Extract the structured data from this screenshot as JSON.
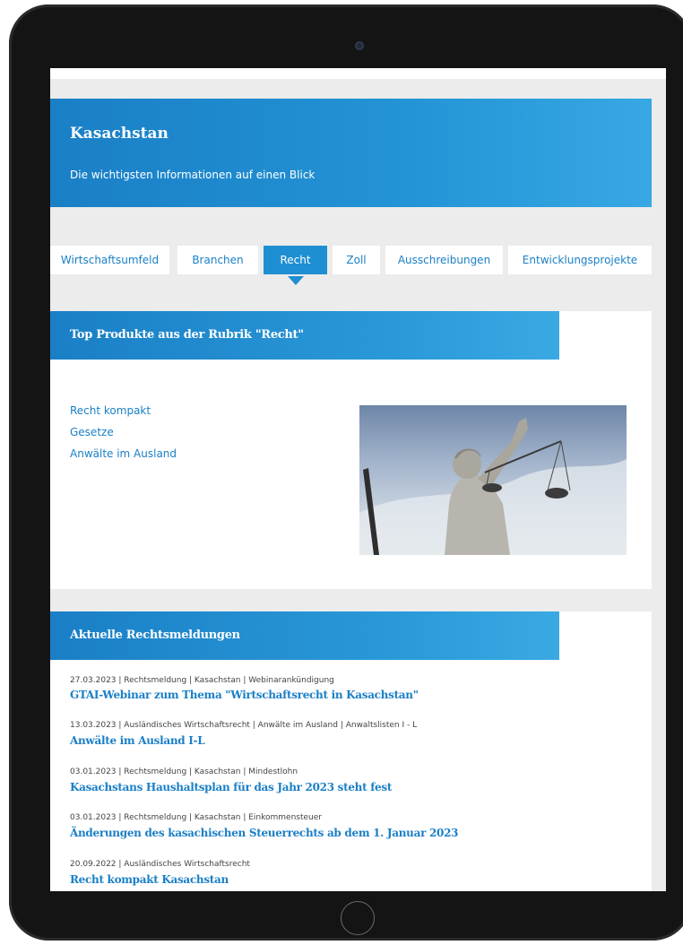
{
  "hero": {
    "title": "Kasachstan",
    "subtitle": "Die wichtigsten Informationen auf einen Blick"
  },
  "tabs": [
    {
      "label": "Wirtschaftsumfeld",
      "active": false
    },
    {
      "label": "Branchen",
      "active": false
    },
    {
      "label": "Recht",
      "active": true
    },
    {
      "label": "Zoll",
      "active": false
    },
    {
      "label": "Ausschreibungen",
      "active": false
    },
    {
      "label": "Entwicklungsprojekte",
      "active": false
    }
  ],
  "top_products": {
    "heading": "Top Produkte aus der Rubrik \"Recht\"",
    "links": [
      "Recht kompakt",
      "Gesetze",
      "Anwälte im Ausland"
    ],
    "image_icon": "justitia-statue-image"
  },
  "news": {
    "heading": "Aktuelle Rechtsmeldungen",
    "items": [
      {
        "meta": "27.03.2023 | Rechtsmeldung | Kasachstan | Webinarankündigung",
        "title": "GTAI-Webinar zum Thema \"Wirtschaftsrecht in Kasachstan\""
      },
      {
        "meta": "13.03.2023 | Ausländisches Wirtschaftsrecht | Anwälte im Ausland | Anwaltslisten I - L",
        "title": "Anwälte im Ausland I-L"
      },
      {
        "meta": "03.01.2023 | Rechtsmeldung | Kasachstan | Mindestlohn",
        "title": "Kasachstans Haushaltsplan für das Jahr 2023 steht fest"
      },
      {
        "meta": "03.01.2023 | Rechtsmeldung | Kasachstan | Einkommensteuer",
        "title": "Änderungen des kasachischen Steuerrechts ab dem 1. Januar 2023"
      },
      {
        "meta": "20.09.2022 | Ausländisches Wirtschaftsrecht",
        "title": "Recht kompakt Kasachstan"
      }
    ]
  },
  "colors": {
    "accent": "#1a7fc6",
    "accent_light": "#37a8e3",
    "page_bg": "#ececec",
    "device_frame": "#141414"
  }
}
